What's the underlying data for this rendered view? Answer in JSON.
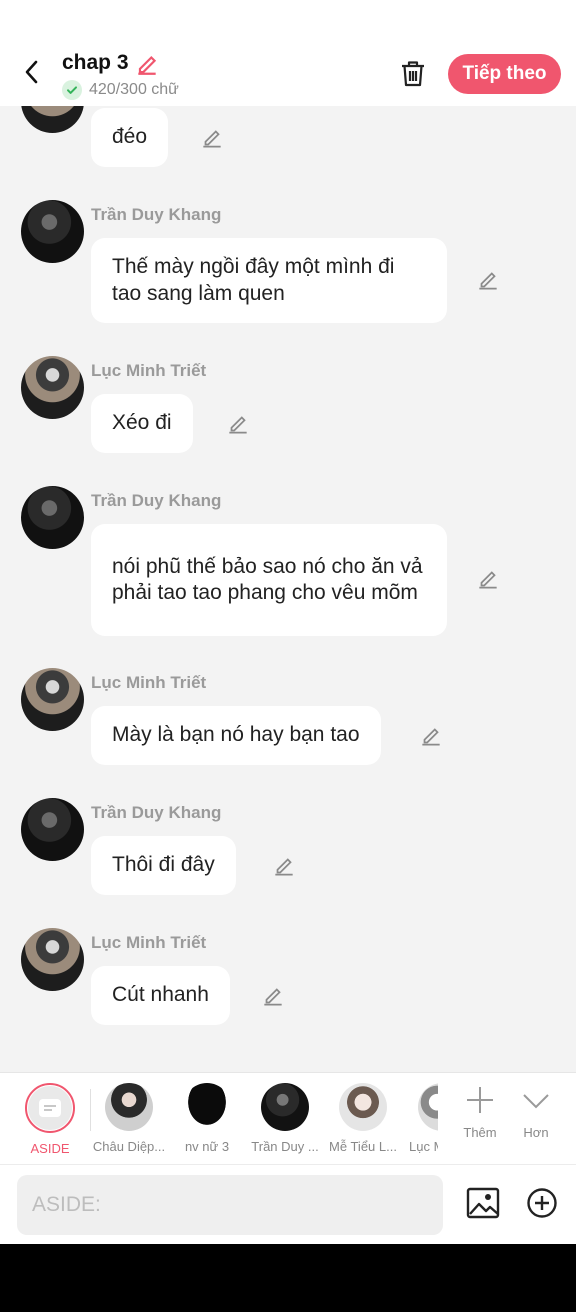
{
  "header": {
    "title": "chap 3",
    "word_count": "420/300 chữ",
    "next_label": "Tiếp theo"
  },
  "messages": [
    {
      "sender": "",
      "text": "đéo",
      "avatar": "triet"
    },
    {
      "sender": "Trần Duy Khang",
      "text": "Thế mày ngồi đây một mình đi tao sang làm quen",
      "avatar": "khang"
    },
    {
      "sender": "Lục Minh Triết",
      "text": "Xéo đi",
      "avatar": "triet"
    },
    {
      "sender": "Trần Duy Khang",
      "text": "nói phũ thế bảo sao nó cho ăn vả phải tao tao phang cho vêu mõm",
      "avatar": "khang"
    },
    {
      "sender": "Lục Minh Triết",
      "text": "Mày là bạn nó hay bạn tao",
      "avatar": "triet"
    },
    {
      "sender": "Trần Duy Khang",
      "text": "Thôi đi đây",
      "avatar": "khang"
    },
    {
      "sender": "Lục Minh Triết",
      "text": "Cút nhanh",
      "avatar": "triet"
    }
  ],
  "characters": [
    {
      "label": "ASIDE"
    },
    {
      "label": "Châu Diệp..."
    },
    {
      "label": "nv nữ 3"
    },
    {
      "label": "Trần Duy ..."
    },
    {
      "label": "Mễ Tiểu L..."
    },
    {
      "label": "Lục M"
    }
  ],
  "tools": {
    "add_label": "Thêm",
    "more_label": "Hơn"
  },
  "input": {
    "placeholder": "ASIDE:"
  },
  "colors": {
    "accent": "#f0566e",
    "background": "#f3f3f3",
    "bubble": "#ffffff"
  }
}
